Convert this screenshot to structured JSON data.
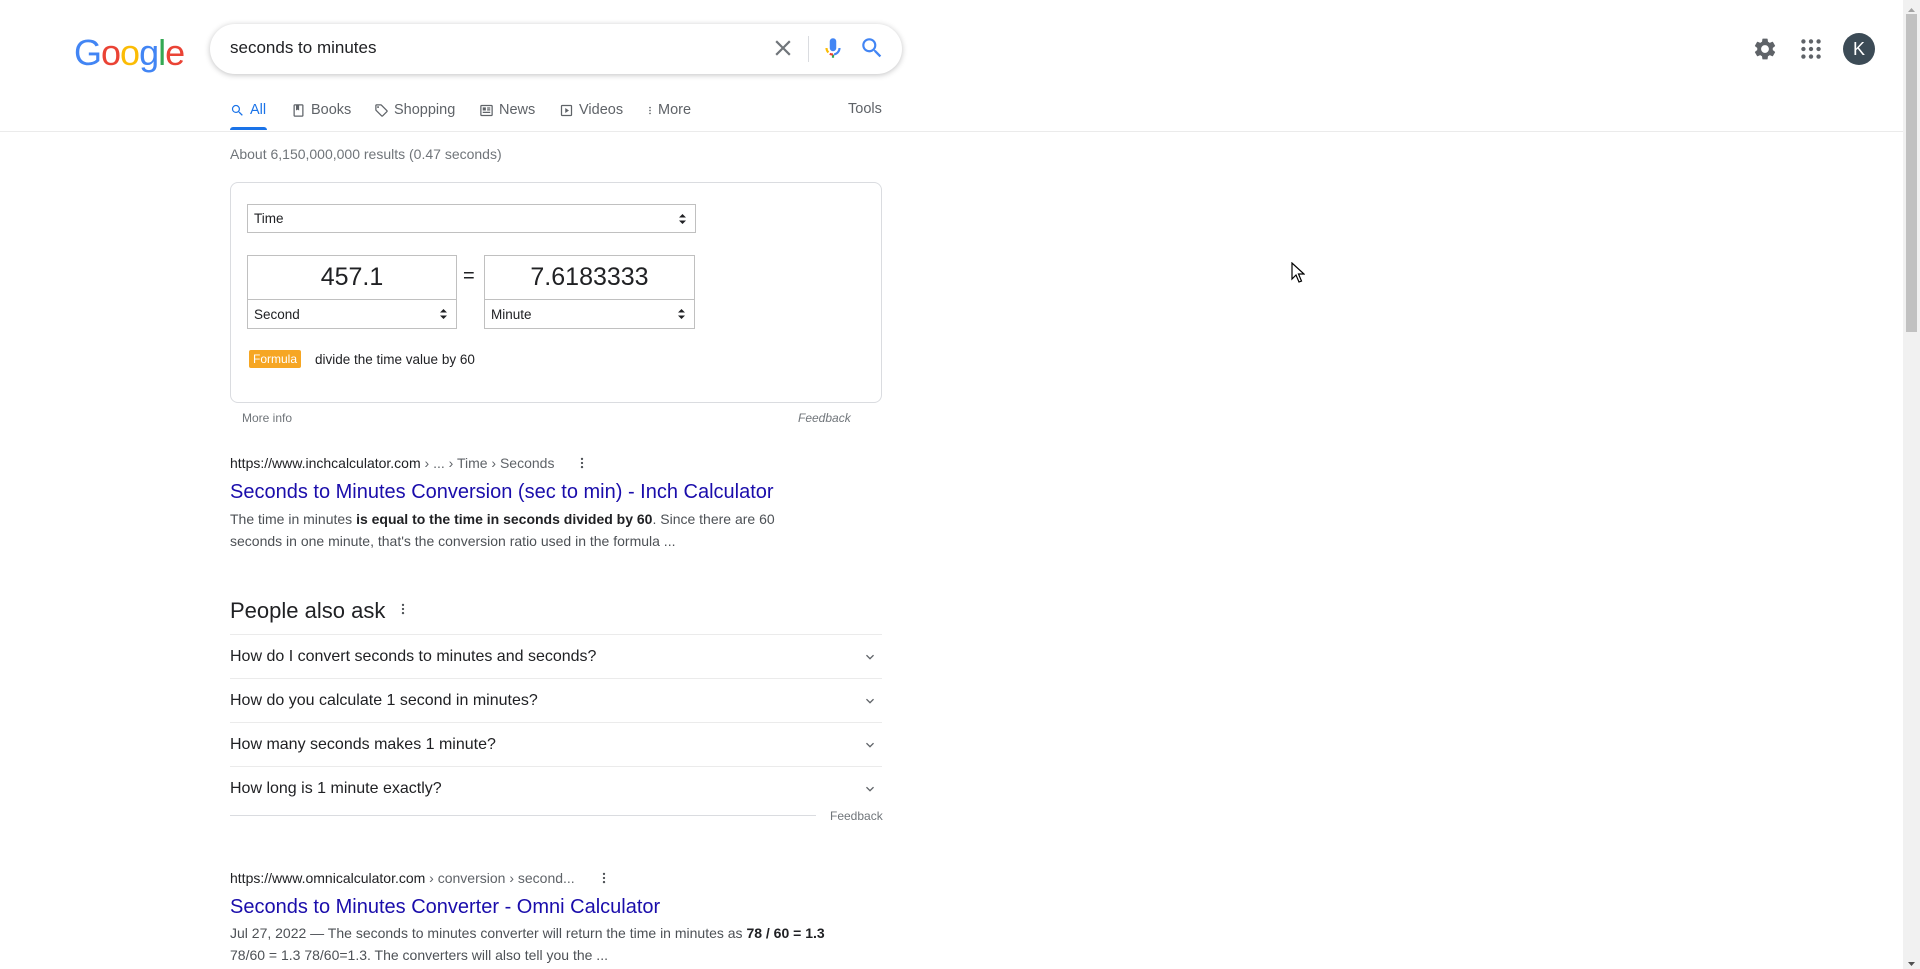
{
  "header": {
    "logo_text": "Google",
    "search_value": "seconds to minutes",
    "avatar_letter": "K"
  },
  "tabs": [
    {
      "label": "All",
      "active": true
    },
    {
      "label": "Books"
    },
    {
      "label": "Shopping"
    },
    {
      "label": "News"
    },
    {
      "label": "Videos"
    },
    {
      "label": "More"
    }
  ],
  "tools_label": "Tools",
  "stats": "About 6,150,000,000 results (0.47 seconds)",
  "converter": {
    "unit_type": "Time",
    "from_value": "457.1",
    "to_value": "7.6183333",
    "from_unit": "Second",
    "to_unit": "Minute",
    "equals": "=",
    "formula_label": "Formula",
    "formula_text": "divide the time value by 60",
    "more_info": "More info",
    "feedback": "Feedback"
  },
  "results": [
    {
      "url_host": "https://www.inchcalculator.com",
      "url_path": " › ... › Time › Seconds",
      "title": "Seconds to Minutes Conversion (sec to min) - Inch Calculator",
      "snippet_pre": "The time in minutes ",
      "snippet_bold": "is equal to the time in seconds divided by 60",
      "snippet_post": ". Since there are 60 seconds in one minute, that's the conversion ratio used in the formula ..."
    },
    {
      "url_host": "https://www.omnicalculator.com",
      "url_path": " › conversion › second...",
      "title": "Seconds to Minutes Converter - Omni Calculator",
      "snippet_pre": "Jul 27, 2022 — The seconds to minutes converter will return the time in minutes as ",
      "snippet_bold": "78 / 60 = 1.3",
      "snippet_post": " 78/60 = 1.3 78/60=1.3. The converters will also tell you the ..."
    }
  ],
  "people_also_ask": {
    "heading": "People also ask",
    "questions": [
      "How do I convert seconds to minutes and seconds?",
      "How do you calculate 1 second in minutes?",
      "How many seconds makes 1 minute?",
      "How long is 1 minute exactly?"
    ],
    "feedback": "Feedback"
  },
  "colors": {
    "link": "#1a0dab",
    "accent": "#1a73e8",
    "formula_badge": "#f6a623"
  }
}
